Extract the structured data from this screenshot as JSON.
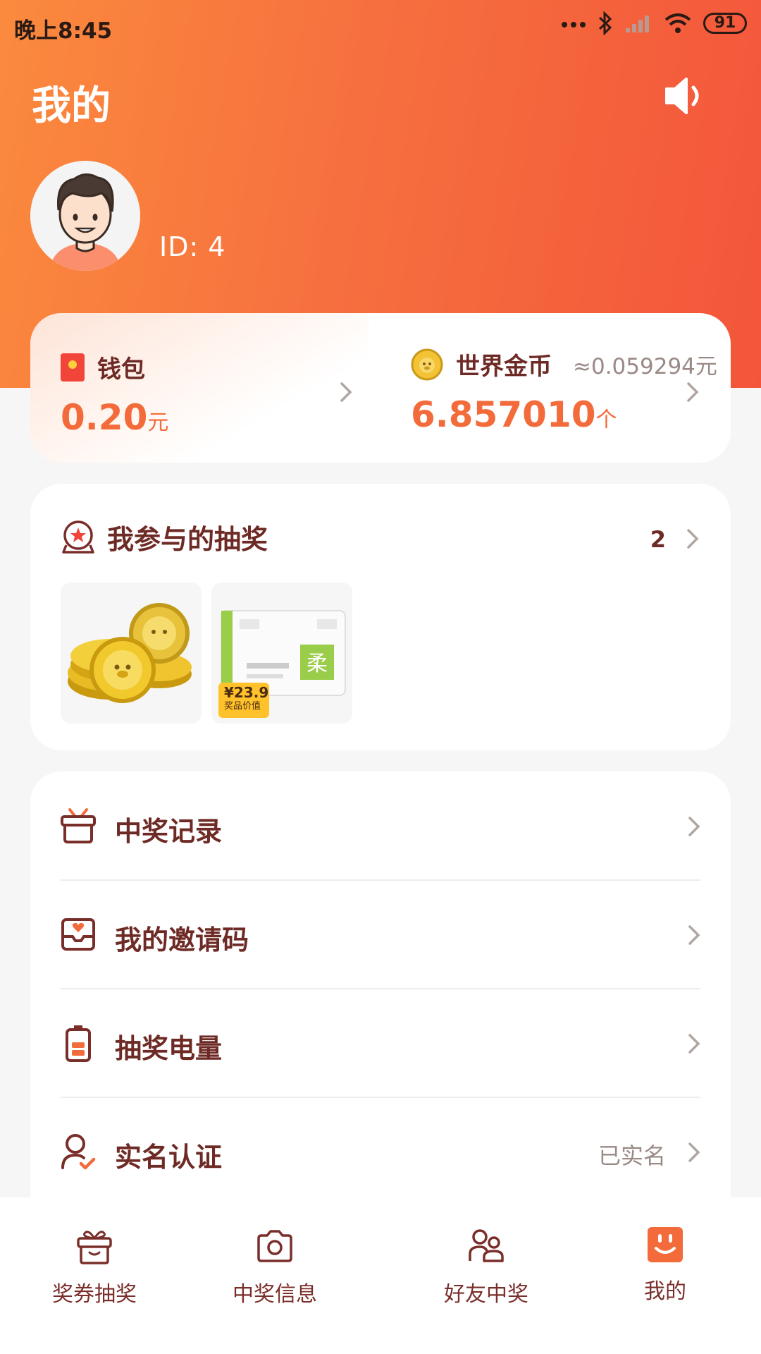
{
  "status_bar": {
    "time": "晚上8:45",
    "battery": "91"
  },
  "header": {
    "title": "我的",
    "user_id": "ID: 4"
  },
  "wallet": {
    "label": "钱包",
    "amount": "0.20",
    "unit": "元"
  },
  "coins": {
    "label": "世界金币",
    "approx": "≈0.059294元",
    "amount": "6.857010",
    "unit": "个"
  },
  "lottery": {
    "title": "我参与的抽奖",
    "count": "2",
    "items": [
      {
        "name": "gold-coins"
      },
      {
        "name": "tissue-pack",
        "price": "¥23.9",
        "price_label": "奖品价值"
      }
    ]
  },
  "menu": [
    {
      "label": "中奖记录",
      "value": "",
      "icon": "gift-box-icon"
    },
    {
      "label": "我的邀请码",
      "value": "",
      "icon": "invite-envelope-icon"
    },
    {
      "label": "抽奖电量",
      "value": "",
      "icon": "battery-icon"
    },
    {
      "label": "实名认证",
      "value": "已实名",
      "icon": "verified-user-icon"
    }
  ],
  "nav": [
    {
      "label": "奖券抽奖",
      "icon": "gift-icon",
      "active": false
    },
    {
      "label": "中奖信息",
      "icon": "camera-icon",
      "active": false
    },
    {
      "label": "好友中奖",
      "icon": "friends-icon",
      "active": false
    },
    {
      "label": "我的",
      "icon": "smile-face-icon",
      "active": true
    }
  ],
  "colors": {
    "accent": "#f36b3a",
    "gradient_start": "#fb8a3e",
    "gradient_end": "#f3553a",
    "text_primary": "#6e2a25"
  }
}
